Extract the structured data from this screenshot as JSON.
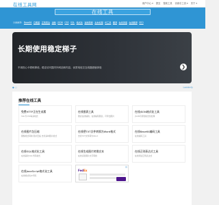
{
  "header": {
    "site_title": "在线工具网",
    "links": [
      "用户中心 ▾",
      "提交",
      "搜索工具",
      "请索引工具 ▾",
      "关于 ▾"
    ]
  },
  "hero": {
    "search_text": "在线工具",
    "tags_label": "分类推荐:",
    "tags": [
      "Base64",
      "日期差",
      "正则表达",
      "进制",
      "JSON",
      "CSS",
      "SQL",
      "格式化",
      "进制转换",
      "文本处理",
      "AI工具",
      "翻译",
      "在线测速",
      "在线翻译",
      "SEO"
    ]
  },
  "banner": {
    "title": "长期使用稳定梯子",
    "description": "不用担心卡顿和掉线，稳定访问国内外网站和内容，优质电信交互线路超值体验",
    "next_icon": "chevron-right-icon",
    "next_glyph": "❯",
    "foot_left": "● ○",
    "foot_right": "Ladderfy"
  },
  "section": {
    "title": "推荐在线工具",
    "cards": [
      {
        "name": "免费HTTP正在生成素",
        "desc": "SSL与CSS等多格式"
      },
      {
        "name": "在线图表工具",
        "desc": "图表在线编辑，在线编辑图表，可导出图片"
      },
      {
        "name": "在线JSON格式化工具",
        "desc": "JSON可视化格式化处理"
      },
      {
        "name": "在线图片包压缩",
        "desc": "图像格式转换 图片压缩 支持多种图片格式"
      },
      {
        "name": "在线把TXT文件转换为Word格式",
        "desc": "支持TXT文件转为Word"
      },
      {
        "name": "在线Base64编码工具",
        "desc": "在线编码工具"
      },
      {
        "name": "在线SQL格式化工具",
        "desc": "在线美化SQL代码格式"
      },
      {
        "name": "在线生成图片转换文本",
        "desc": "在线识别图片文字转换"
      },
      {
        "name": "在线正则表达式工具",
        "desc": "在线测试正则表达式"
      },
      {
        "name": "在线JavaScript格式化工具",
        "desc": "在线格式化JS代码"
      }
    ],
    "ad": {
      "brand_main": "Fed",
      "brand_accent": "Ex"
    }
  },
  "colors": {
    "accent": "#2f95d4",
    "banner_dark": "#2a2d31",
    "panel_bg": "#ffffff",
    "page_bg": "#f1f1f1"
  }
}
